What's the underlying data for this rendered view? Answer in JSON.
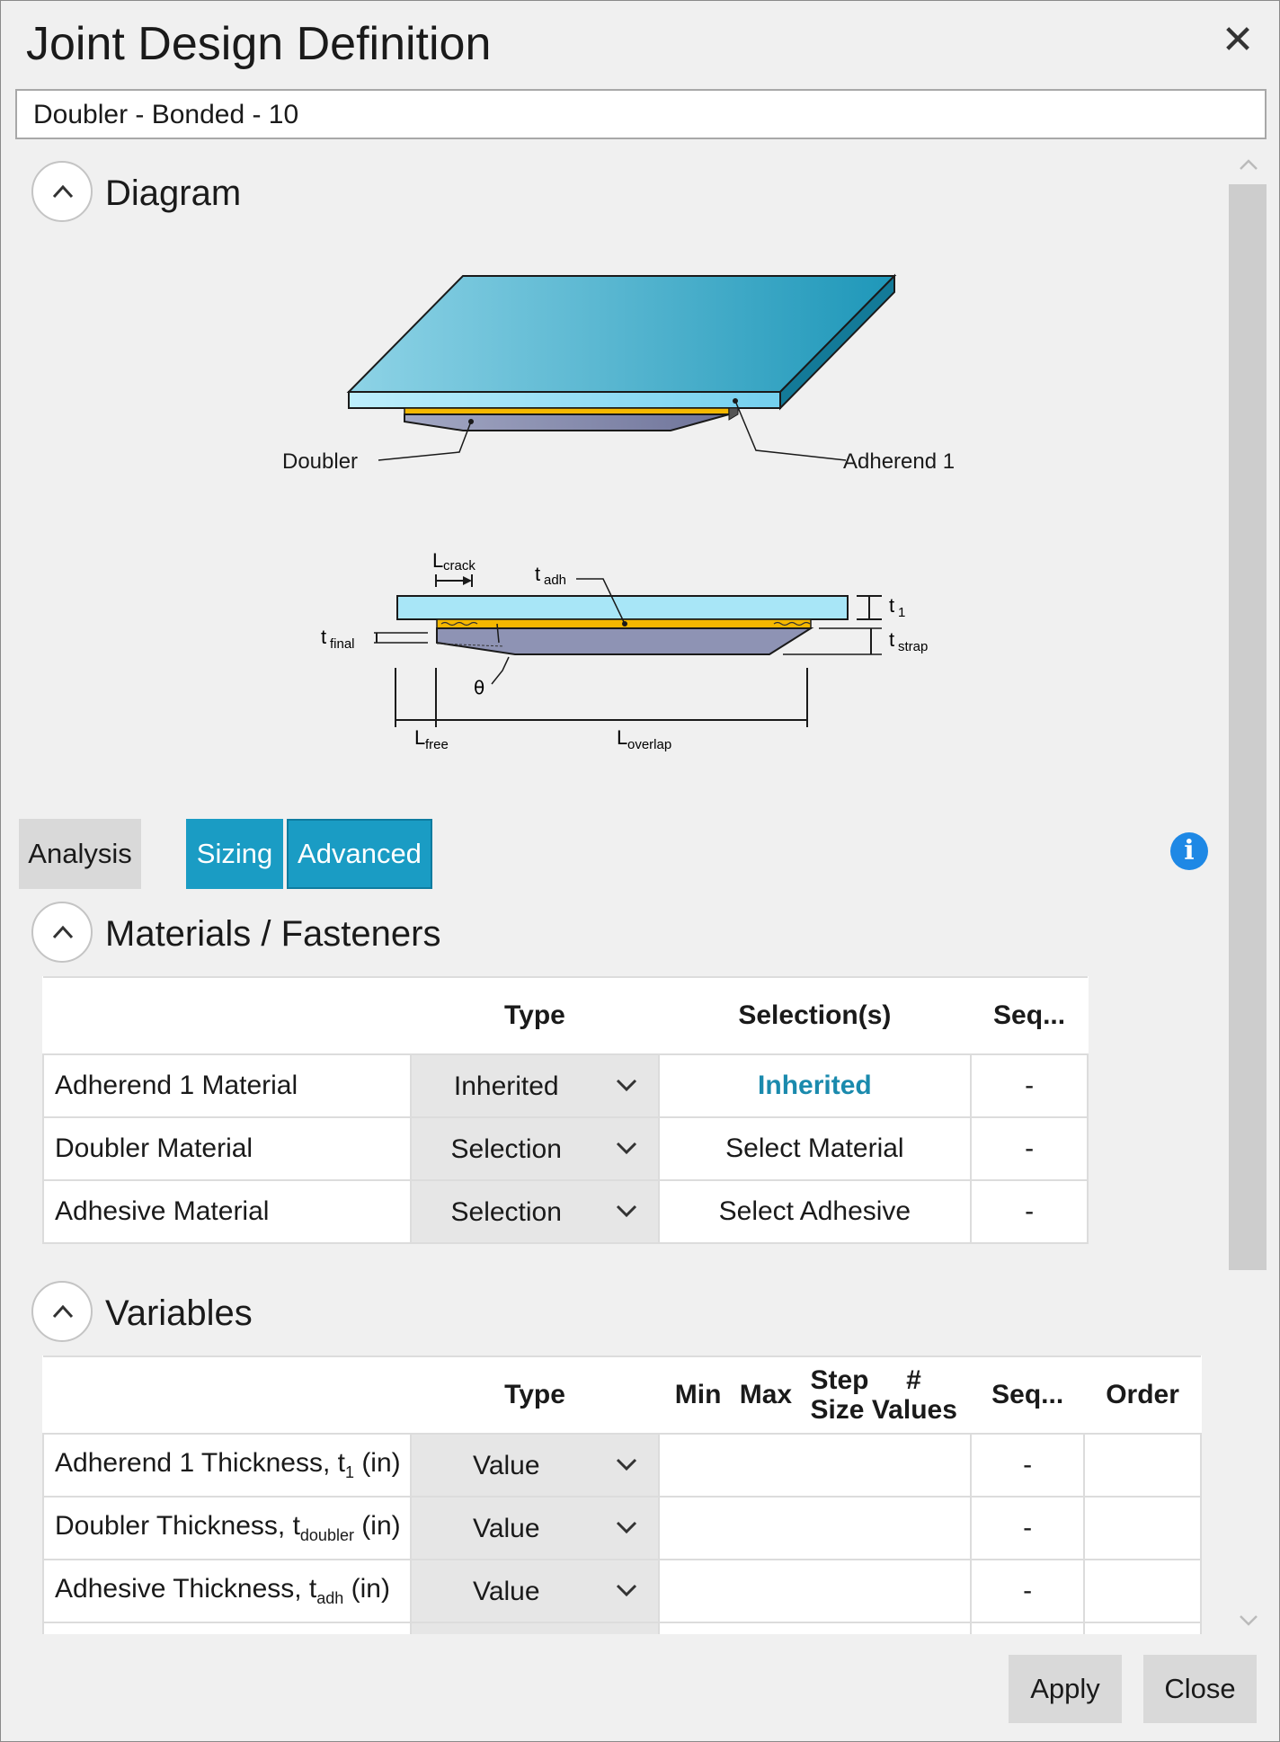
{
  "dialog": {
    "title": "Joint Design Definition",
    "close_symbol": "✕",
    "name_value": "Doubler - Bonded - 10"
  },
  "sections": {
    "diagram_title": "Diagram",
    "materials_title": "Materials / Fasteners",
    "variables_title": "Variables"
  },
  "diagram": {
    "doubler_label": "Doubler",
    "adherend_label": "Adherend 1",
    "l_crack": "L",
    "l_crack_sub": "crack",
    "t_adh": "t",
    "t_adh_sub": "adh",
    "t_1": "t",
    "t_1_sub": "1",
    "t_final": "t",
    "t_final_sub": "final",
    "t_strap": "t",
    "t_strap_sub": "strap",
    "theta": "θ",
    "l_free": "L",
    "l_free_sub": "free",
    "l_overlap": "L",
    "l_overlap_sub": "overlap"
  },
  "tabs": {
    "analysis": "Analysis",
    "sizing": "Sizing",
    "advanced": "Advanced"
  },
  "info_glyph": "i",
  "materials_table": {
    "headers": {
      "type": "Type",
      "selections": "Selection(s)",
      "seq": "Seq..."
    },
    "rows": [
      {
        "label": "Adherend 1 Material",
        "type": "Inherited",
        "selection": "Inherited",
        "seq": "-"
      },
      {
        "label": "Doubler Material",
        "type": "Selection",
        "selection": "Select Material",
        "seq": "-"
      },
      {
        "label": "Adhesive Material",
        "type": "Selection",
        "selection": "Select Adhesive",
        "seq": "-"
      }
    ]
  },
  "variables_table": {
    "headers": {
      "type": "Type",
      "min": "Min",
      "max": "Max",
      "step": "Step",
      "size": "Size",
      "hash": "#",
      "values": "Values",
      "seq": "Seq...",
      "order": "Order"
    },
    "rows": [
      {
        "label": "Adherend 1 Thickness, t",
        "sub": "1",
        "unit": " (in)",
        "type": "Value",
        "seq": "-"
      },
      {
        "label": "Doubler Thickness, t",
        "sub": "doubler",
        "unit": " (in)",
        "type": "Value",
        "seq": "-"
      },
      {
        "label": "Adhesive Thickness, t",
        "sub": "adh",
        "unit": " (in)",
        "type": "Value",
        "seq": "-"
      }
    ]
  },
  "buttons": {
    "apply": "Apply",
    "close": "Close"
  },
  "colors": {
    "accent": "#1a9cc4",
    "link": "#1a8aad",
    "info": "#1e88e5"
  }
}
